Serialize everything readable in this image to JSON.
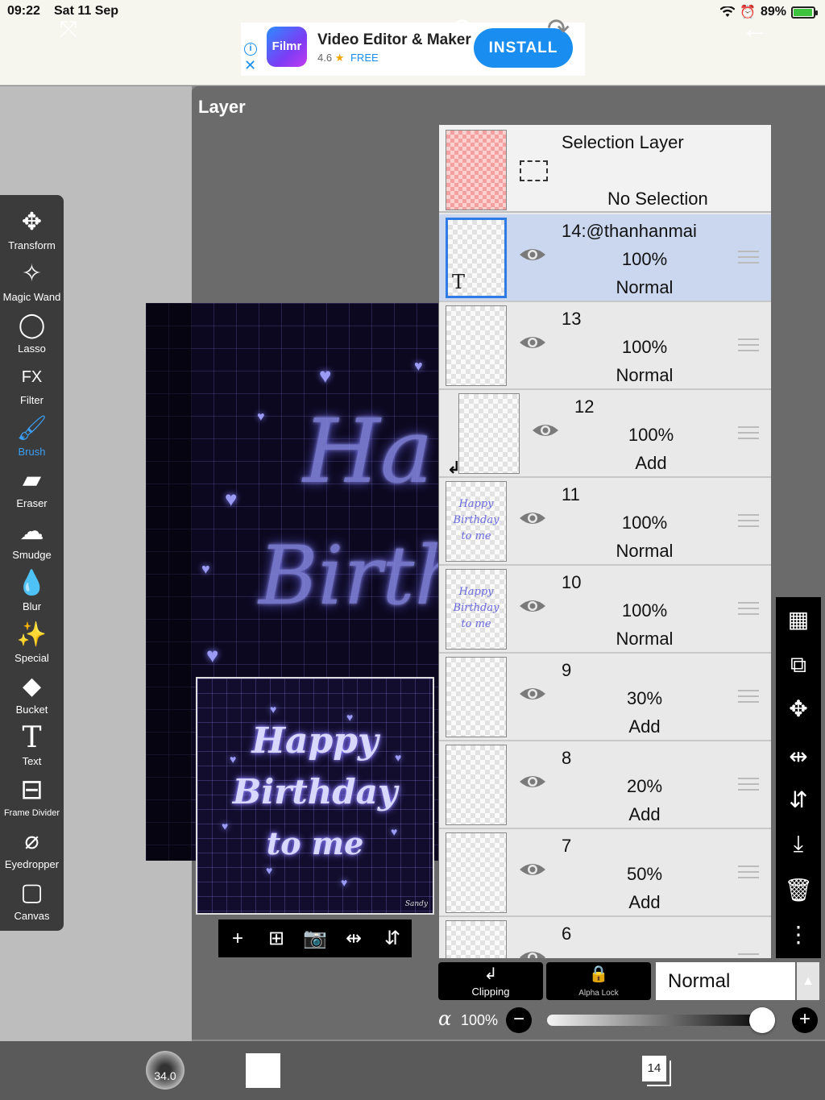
{
  "status_bar": {
    "time": "09:22",
    "date": "Sat 11 Sep",
    "battery": "89%"
  },
  "ad": {
    "logo_text": "Filmr",
    "title": "Video Editor & Maker",
    "rating": "4.6",
    "price": "FREE",
    "install_label": "INSTALL"
  },
  "panel_title": "Layer",
  "tools": [
    {
      "label": "Transform",
      "icon": "move-arrows-icon"
    },
    {
      "label": "Magic Wand",
      "icon": "magic-wand-icon"
    },
    {
      "label": "Lasso",
      "icon": "lasso-icon"
    },
    {
      "label": "Filter",
      "icon": "fx-icon",
      "glyph": "FX"
    },
    {
      "label": "Brush",
      "icon": "brush-icon",
      "active": true
    },
    {
      "label": "Eraser",
      "icon": "eraser-icon"
    },
    {
      "label": "Smudge",
      "icon": "smudge-icon"
    },
    {
      "label": "Blur",
      "icon": "droplet-icon"
    },
    {
      "label": "Special",
      "icon": "sparkle-wand-icon"
    },
    {
      "label": "Bucket",
      "icon": "bucket-icon"
    },
    {
      "label": "Text",
      "icon": "text-icon",
      "glyph": "T"
    },
    {
      "label": "Frame Divider",
      "icon": "frame-divider-icon"
    },
    {
      "label": "Eyedropper",
      "icon": "eyedropper-icon"
    },
    {
      "label": "Canvas",
      "icon": "canvas-icon"
    }
  ],
  "canvas_art": {
    "line1": "Ha",
    "line2": "Birth"
  },
  "thumbnail": {
    "line1": "Happy",
    "line2": "Birthday",
    "line3": "to me",
    "signature": "Sandy"
  },
  "selection_layer": {
    "name": "Selection Layer",
    "status": "No Selection"
  },
  "layers": [
    {
      "name": "14:@thanhanmai",
      "opacity": "100%",
      "blend": "Normal",
      "selected": true,
      "text_layer": true
    },
    {
      "name": "13",
      "opacity": "100%",
      "blend": "Normal"
    },
    {
      "name": "12",
      "opacity": "100%",
      "blend": "Add",
      "clipped": true
    },
    {
      "name": "11",
      "opacity": "100%",
      "blend": "Normal",
      "thumb_text": "Happy Birthday to me"
    },
    {
      "name": "10",
      "opacity": "100%",
      "blend": "Normal",
      "thumb_text": "Happy Birthday to me"
    },
    {
      "name": "9",
      "opacity": "30%",
      "blend": "Add"
    },
    {
      "name": "8",
      "opacity": "20%",
      "blend": "Add"
    },
    {
      "name": "7",
      "opacity": "50%",
      "blend": "Add"
    },
    {
      "name": "6",
      "opacity": "",
      "blend": ""
    }
  ],
  "layer_controls": {
    "clipping_label": "Clipping",
    "alpha_lock_label": "Alpha Lock",
    "blend_mode": "Normal",
    "alpha_symbol": "α",
    "opacity": "100%",
    "opacity_fraction": 1.0
  },
  "bottom_bar": {
    "brush_size": "34.0",
    "layer_count": "14",
    "color": "#ffffff"
  },
  "colors": {
    "accent": "#3a9ef5",
    "selected_row": "#cbd7ef",
    "install": "#1a8ef0"
  }
}
